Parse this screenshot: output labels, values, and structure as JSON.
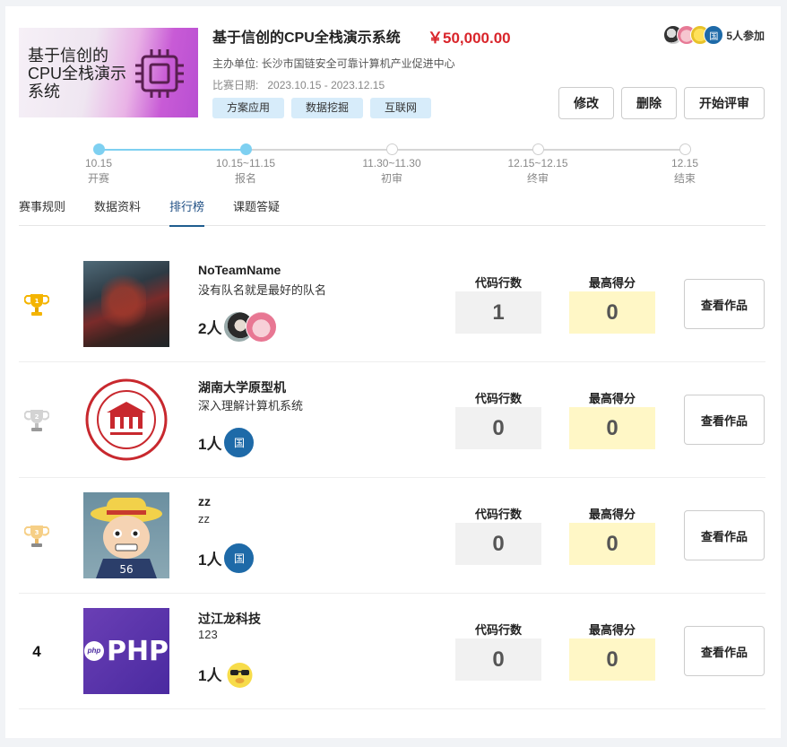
{
  "header": {
    "banner_text": "基于信创的CPU全栈演示系统",
    "title": "基于信创的CPU全栈演示系统",
    "prize": "￥50,000.00",
    "organizer": "主办单位: 长沙市国链安全可靠计算机产业促进中心",
    "dates_label": "比赛日期:",
    "dates_value": "2023.10.15 - 2023.12.15",
    "tags": [
      "方案应用",
      "数据挖掘",
      "互联网"
    ],
    "participants_badge": "国",
    "participants_count": "5人参加",
    "buttons": {
      "edit": "修改",
      "delete": "删除",
      "start_review": "开始评审"
    }
  },
  "timeline": [
    {
      "date": "10.15",
      "label": "开赛",
      "active": true
    },
    {
      "date": "10.15~11.15",
      "label": "报名",
      "active": true
    },
    {
      "date": "11.30~11.30",
      "label": "初审",
      "active": false
    },
    {
      "date": "12.15~12.15",
      "label": "终审",
      "active": false
    },
    {
      "date": "12.15",
      "label": "结束",
      "active": false
    }
  ],
  "tabs": [
    "赛事规则",
    "数据资料",
    "排行榜",
    "课题答疑"
  ],
  "active_tab": 2,
  "ranking": {
    "code_label": "代码行数",
    "score_label": "最高得分",
    "view_label": "查看作品",
    "rows": [
      {
        "rank": "1",
        "medal": "gold",
        "name": "NoTeamName",
        "desc": "没有队名就是最好的队名",
        "members": "2人",
        "code_lines": "1",
        "score": "0"
      },
      {
        "rank": "2",
        "medal": "silver",
        "name": "湖南大学原型机",
        "desc": "深入理解计算机系统",
        "members": "1人",
        "member_badge": "国",
        "code_lines": "0",
        "score": "0"
      },
      {
        "rank": "3",
        "medal": "bronze",
        "name": "zz",
        "desc": "zz",
        "members": "1人",
        "member_badge": "国",
        "code_lines": "0",
        "score": "0"
      },
      {
        "rank": "4",
        "medal": "",
        "name": "过江龙科技",
        "desc": "123",
        "members": "1人",
        "logo_text": "PHP",
        "logo_badge": "php",
        "code_lines": "0",
        "score": "0"
      }
    ]
  },
  "colors": {
    "prize": "#d9252b",
    "tag_bg": "#d7ecfa",
    "timeline_active": "#7ed0f1",
    "tab_active": "#1f5d8f",
    "code_box": "#f1f1f1",
    "score_box": "#fff7c6"
  }
}
